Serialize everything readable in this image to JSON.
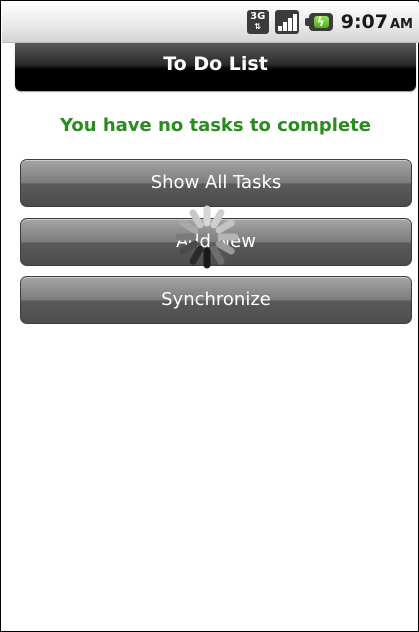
{
  "status_bar": {
    "network_label": "3G",
    "time": "9:07",
    "ampm": "AM",
    "battery_color": "#4caf1e"
  },
  "app": {
    "title": "To Do List"
  },
  "message": {
    "text": "You have no tasks to complete",
    "color": "#2a8b1e"
  },
  "buttons": {
    "show_all": "Show All Tasks",
    "add_new": "Add New",
    "sync": "Synchronize"
  }
}
